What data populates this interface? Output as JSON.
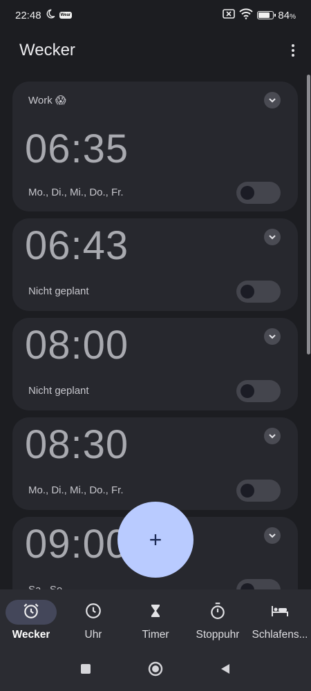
{
  "status_bar": {
    "time": "22:48",
    "moon_icon": "moon-icon",
    "wear_badge": "Wear",
    "battery": "84",
    "battery_unit": "%",
    "battery_level": 0.84
  },
  "header": {
    "title": "Wecker"
  },
  "alarms": [
    {
      "label": "Work 😱",
      "time": "06:35",
      "schedule": "Mo., Di., Mi., Do., Fr.",
      "enabled": false
    },
    {
      "label": "",
      "time": "06:43",
      "schedule": "Nicht geplant",
      "enabled": false
    },
    {
      "label": "",
      "time": "08:00",
      "schedule": "Nicht geplant",
      "enabled": false
    },
    {
      "label": "",
      "time": "08:30",
      "schedule": "Mo., Di., Mi., Do., Fr.",
      "enabled": false
    },
    {
      "label": "",
      "time": "09:00",
      "schedule": "Sa., So.",
      "enabled": false
    }
  ],
  "fab": {
    "symbol": "+"
  },
  "bottom_nav": [
    {
      "label": "Wecker",
      "icon": "alarm-clock-icon",
      "active": true
    },
    {
      "label": "Uhr",
      "icon": "clock-icon",
      "active": false
    },
    {
      "label": "Timer",
      "icon": "hourglass-icon",
      "active": false
    },
    {
      "label": "Stoppuhr",
      "icon": "stopwatch-icon",
      "active": false
    },
    {
      "label": "Schlafens...",
      "icon": "bed-icon",
      "active": false
    }
  ],
  "colors": {
    "background": "#1c1d21",
    "card": "#27282e",
    "accent": "#b9cbff",
    "nav_bg": "#2b2c32"
  }
}
